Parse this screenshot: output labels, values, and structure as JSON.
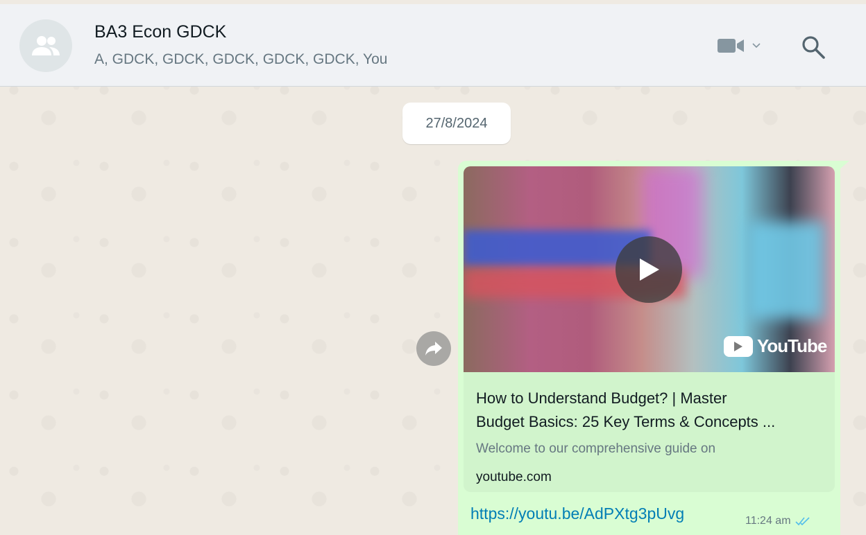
{
  "header": {
    "title": "BA3 Econ GDCK",
    "members": "A, GDCK, GDCK, GDCK, GDCK, GDCK, You"
  },
  "icons": {
    "avatar": "group-icon",
    "video": "video-call-icon",
    "dropdown": "chevron-down-icon",
    "search": "search-icon",
    "forward": "forward-icon",
    "play": "play-icon",
    "ticks": "double-check-icon"
  },
  "chat": {
    "date": "27/8/2024",
    "message": {
      "preview_title_1": "How to Understand Budget? | Master",
      "preview_title_2": "Budget Basics: 25 Key Terms & Concepts ...",
      "preview_description": "Welcome to our comprehensive guide on",
      "preview_domain": "youtube.com",
      "video_brand": "YouTube",
      "link": "https://youtu.be/AdPXtg3pUvg",
      "time": "11:24 am"
    }
  },
  "colors": {
    "header_bg": "#f0f2f5",
    "chat_bg": "#efeae2",
    "bubble": "#d9fdd3",
    "link": "#027eb5",
    "read_ticks": "#53bdeb"
  }
}
